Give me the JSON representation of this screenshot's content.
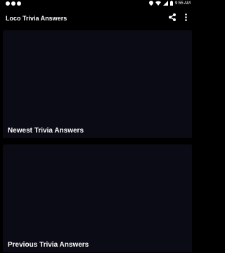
{
  "status_bar": {
    "time": "9:55 AM",
    "left_icons": [
      "notification-icon",
      "notification-icon",
      "notification-icon"
    ],
    "right_icons": [
      "location-icon",
      "wifi-icon",
      "signal-icon",
      "battery-icon"
    ]
  },
  "app_bar": {
    "title": "Loco Trivia Answers",
    "actions": [
      "share-icon",
      "more-vertical-icon"
    ]
  },
  "cards": [
    {
      "label": "Newest Trivia Answers"
    },
    {
      "label": "Previous Trivia Answers"
    }
  ],
  "colors": {
    "background": "#000000",
    "card": "#0b0b16",
    "text": "#ffffff"
  }
}
